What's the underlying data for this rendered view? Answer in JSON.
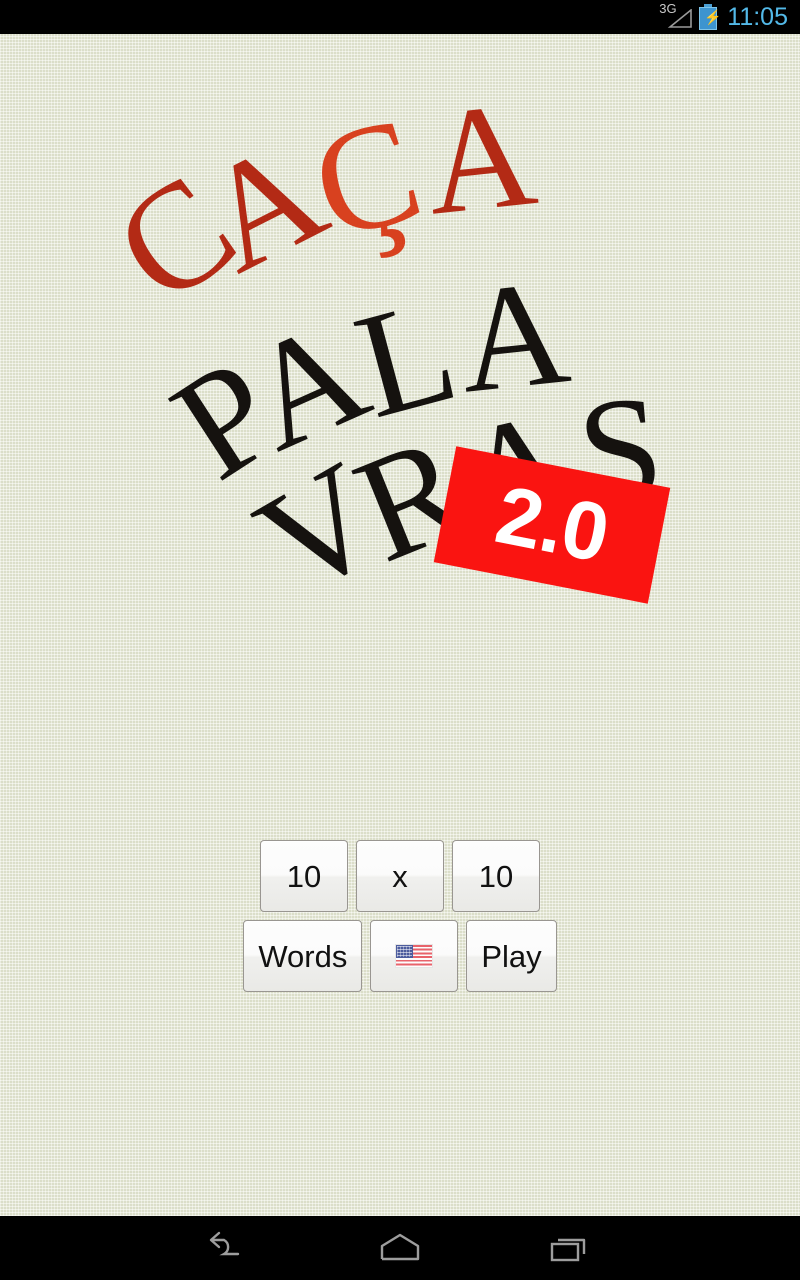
{
  "status_bar": {
    "network_label": "3G",
    "signal_icon": "signal-triangle-icon",
    "battery_icon": "battery-charging-icon",
    "clock": "11:05",
    "clock_color": "#53b9e8"
  },
  "logo": {
    "line1": {
      "text": "CAÇA",
      "letters": [
        "C",
        "A",
        "Ç",
        "A"
      ],
      "color": "#b32a15"
    },
    "line2": {
      "text": "PALA",
      "letters": [
        "P",
        "A",
        "L",
        "A"
      ],
      "color": "#15120f"
    },
    "line3": {
      "text": "VRAS",
      "letters": [
        "V",
        "R",
        "A",
        "S"
      ],
      "color": "#15120f"
    },
    "badge": {
      "text": "2.0",
      "background": "#fa1411",
      "text_color": "#ffffff"
    }
  },
  "controls": {
    "size_row": [
      {
        "name": "width-value",
        "label": "10"
      },
      {
        "name": "multiply-symbol",
        "label": "x"
      },
      {
        "name": "height-value",
        "label": "10"
      }
    ],
    "action_row": [
      {
        "name": "words-button",
        "label": "Words"
      },
      {
        "name": "language-button",
        "label": "",
        "icon": "us-flag-icon"
      },
      {
        "name": "play-button",
        "label": "Play"
      }
    ]
  },
  "nav_bar": {
    "back": "back-icon",
    "home": "home-icon",
    "recents": "recents-icon"
  },
  "theme": {
    "background": "#e4e7d2",
    "button_border": "#999691",
    "accent_red": "#fa1411"
  }
}
